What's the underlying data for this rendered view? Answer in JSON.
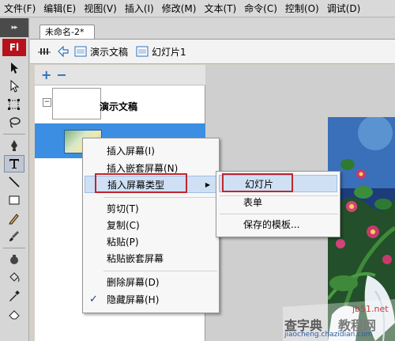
{
  "menubar": {
    "items": [
      "文件(F)",
      "编辑(E)",
      "视图(V)",
      "插入(I)",
      "修改(M)",
      "文本(T)",
      "命令(C)",
      "控制(O)",
      "调试(D)"
    ]
  },
  "tools": {
    "logo": "Fl",
    "grip": "▸▸"
  },
  "document": {
    "tab_label": "未命名-2*"
  },
  "editbar": {
    "scene_label": "演示文稿",
    "slide_label": "幻灯片1"
  },
  "screen_panel": {
    "root_label": "演示文稿",
    "add_button": "+",
    "remove_button": "−",
    "expand_symbol": "−"
  },
  "context_menu": {
    "items": [
      {
        "label": "插入屏幕(I)"
      },
      {
        "label": "插入嵌套屏幕(N)"
      },
      {
        "label": "插入屏幕类型",
        "has_submenu": true,
        "highlighted": true
      },
      {
        "label": "剪切(T)"
      },
      {
        "label": "复制(C)"
      },
      {
        "label": "粘贴(P)"
      },
      {
        "label": "粘贴嵌套屏幕"
      },
      {
        "label": "删除屏幕(D)"
      },
      {
        "label": "隐藏屏幕(H)",
        "checked": true
      }
    ],
    "submenu_arrow": "▶",
    "check_mark": "✓"
  },
  "submenu": {
    "items": [
      {
        "label": "幻灯片",
        "highlighted": true
      },
      {
        "label": "表单"
      },
      {
        "label": "保存的模板..."
      }
    ]
  },
  "watermark": {
    "site": "jb51.net",
    "brand": "查字典",
    "subtitle": "教程网",
    "url": "jiaocheng.chazidian.com"
  },
  "colors": {
    "accent_red": "#c0262c",
    "selection_blue": "#3c8ee2",
    "flash_red": "#b5121b"
  }
}
